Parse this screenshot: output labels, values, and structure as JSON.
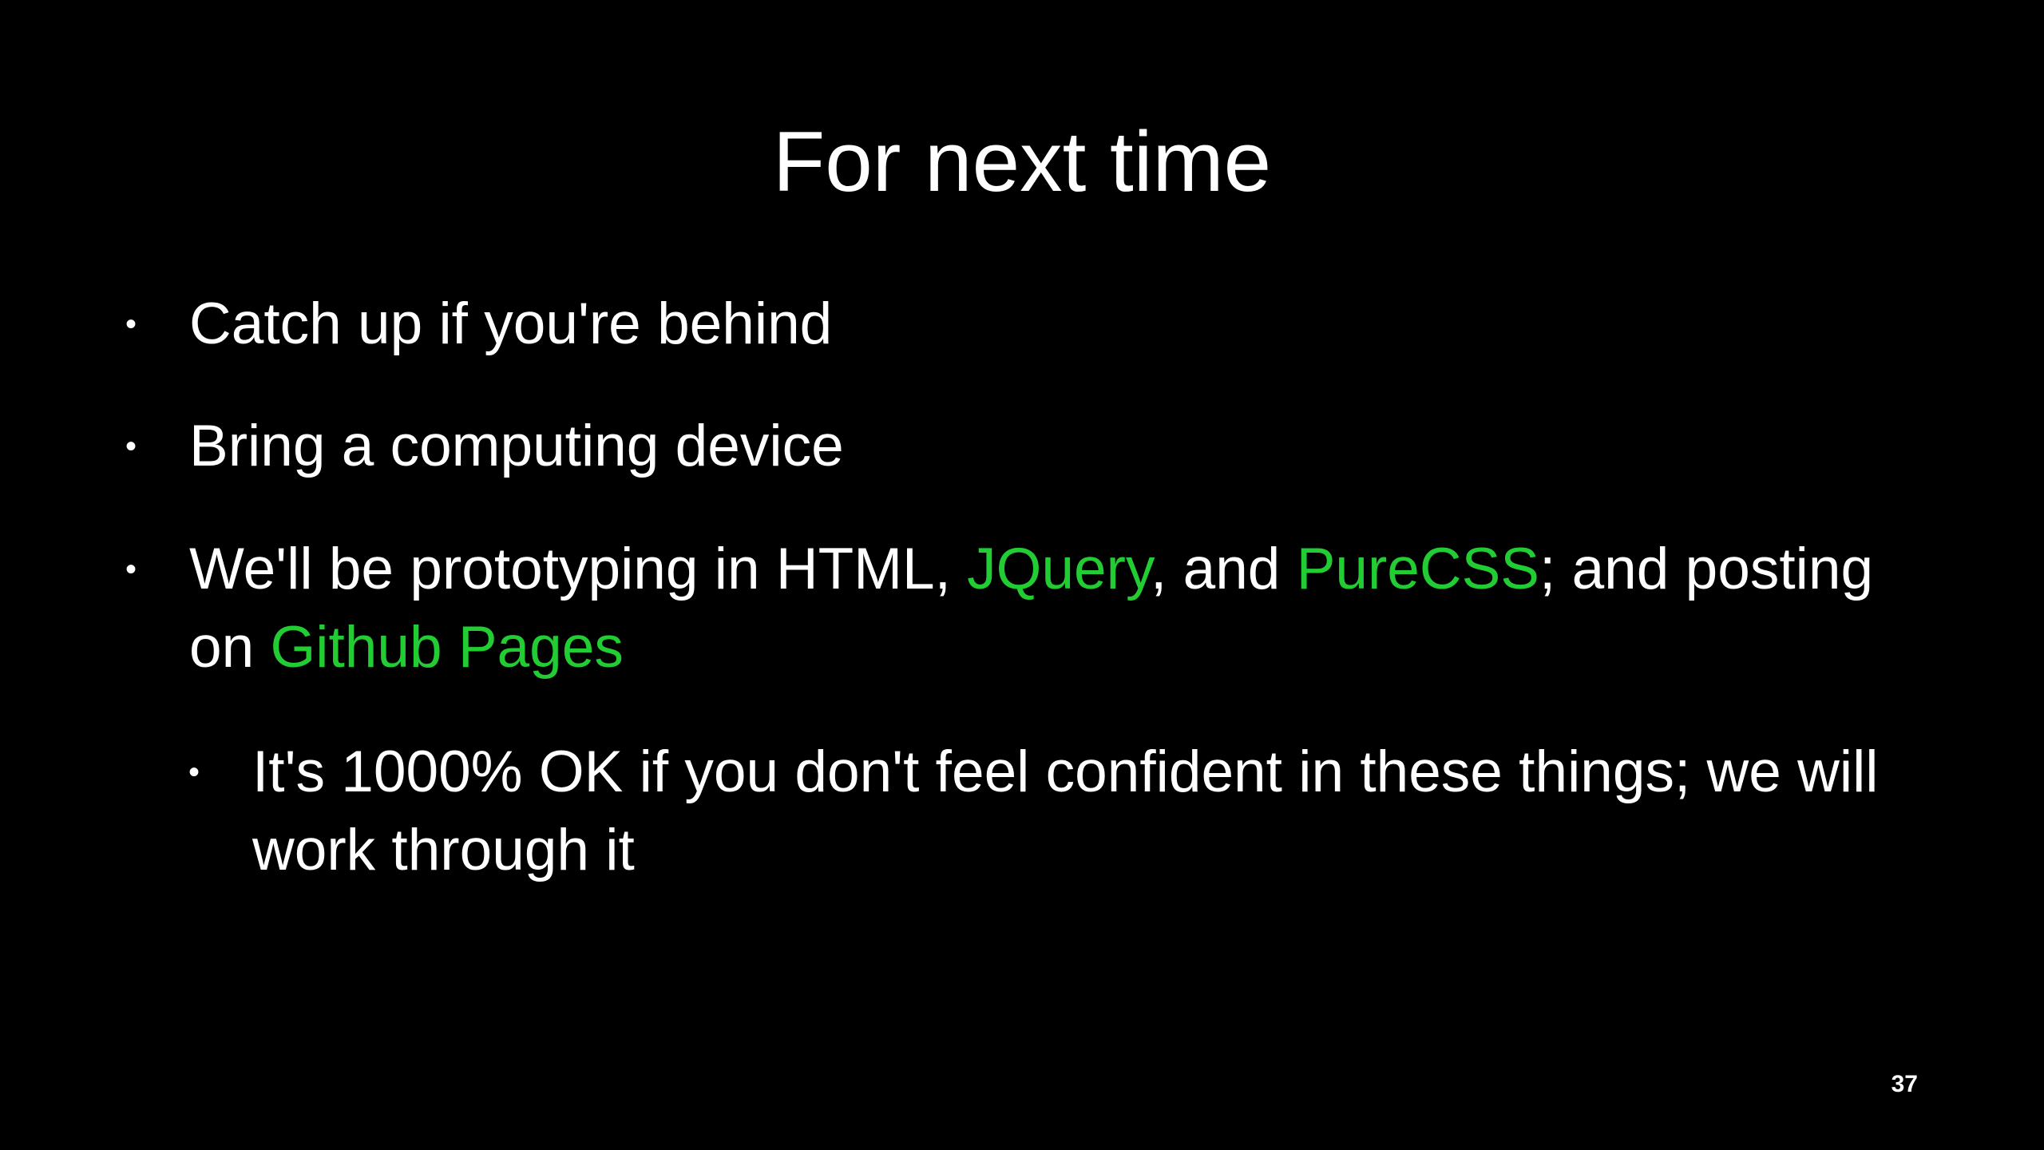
{
  "slide": {
    "title": "For next time",
    "bullet_symbol": "•",
    "bullets": [
      {
        "segments": [
          {
            "text": "Catch up if you're behind"
          }
        ]
      },
      {
        "segments": [
          {
            "text": "Bring a computing device"
          }
        ]
      },
      {
        "segments": [
          {
            "text": "We'll be prototyping in HTML, "
          },
          {
            "text": "JQuery"
          },
          {
            "text": ", and "
          },
          {
            "text": "PureCSS"
          },
          {
            "text": "; and posting on "
          },
          {
            "text": "Github Pages"
          }
        ]
      },
      {
        "level": 2,
        "segments": [
          {
            "text": "It's 1000% OK if you don't feel confident in these things; we will work through it"
          }
        ]
      }
    ],
    "page_number": "37"
  },
  "colors": {
    "background": "#000000",
    "text": "#ffffff",
    "highlight": "#22cc33"
  }
}
